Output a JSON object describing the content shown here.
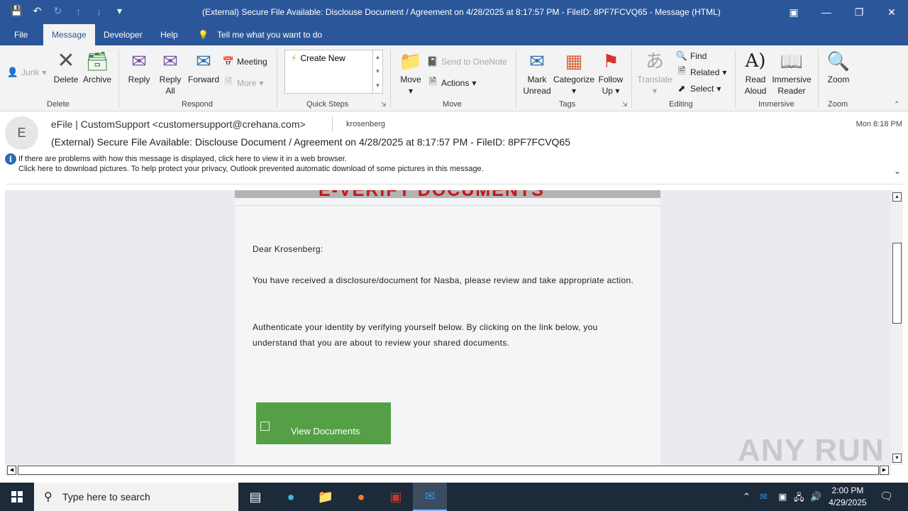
{
  "window": {
    "title": "(External) Secure File Available: Disclouse Document / Agreement on 4/28/2025 at 8:17:57 PM - FileID: 8PF7FCVQ65  -  Message (HTML)"
  },
  "tabs": [
    "File",
    "Message",
    "Developer",
    "Help"
  ],
  "tell_me": "Tell me what you want to do",
  "ribbon": {
    "delete_group": {
      "junk": "Junk",
      "delete": "Delete",
      "archive": "Archive",
      "label": "Delete"
    },
    "respond_group": {
      "reply": "Reply",
      "reply_all_1": "Reply",
      "reply_all_2": "All",
      "forward": "Forward",
      "meeting": "Meeting",
      "more": "More",
      "label": "Respond"
    },
    "quick_steps": {
      "create_new": "Create New",
      "label": "Quick Steps"
    },
    "move_group": {
      "move": "Move",
      "onenote": "Send to OneNote",
      "actions": "Actions",
      "label": "Move"
    },
    "tags_group": {
      "mark_1": "Mark",
      "mark_2": "Unread",
      "categorize": "Categorize",
      "follow_1": "Follow",
      "follow_2": "Up",
      "label": "Tags"
    },
    "editing_group": {
      "translate": "Translate",
      "find": "Find",
      "related": "Related",
      "select": "Select",
      "label": "Editing"
    },
    "immersive_group": {
      "read_1": "Read",
      "read_2": "Aloud",
      "imm_1": "Immersive",
      "imm_2": "Reader",
      "label": "Immersive"
    },
    "zoom_group": {
      "zoom": "Zoom",
      "label": "Zoom"
    }
  },
  "message": {
    "avatar_letter": "E",
    "from": "eFile | CustomSupport <customersupport@crehana.com>",
    "to": "krosenberg",
    "date": "Mon 8:18 PM",
    "subject": "(External) Secure File Available: Disclouse Document / Agreement on 4/28/2025 at 8:17:57 PM - FileID: 8PF7FCVQ65",
    "info_line1": "If there are problems with how this message is displayed, click here to view it in a web browser.",
    "info_line2": "Click here to download pictures. To help protect your privacy, Outlook prevented automatic download of some pictures in this message."
  },
  "email_body": {
    "banner": "E-VERIFY DOCUMENTS",
    "greeting": "Dear Krosenberg:",
    "para1": "You have received a disclosure/document for Nasba, please review and take appropriate action.",
    "para2": "Authenticate your identity by verifying yourself below. By clicking on the link below, you understand that you are about to review your shared documents.",
    "button": "View Documents"
  },
  "watermark": "ANY RUN",
  "taskbar": {
    "search_placeholder": "Type here to search",
    "time": "2:00 PM",
    "date": "4/29/2025"
  },
  "colors": {
    "accent": "#2b579a",
    "button_green": "#55a046",
    "banner_red": "#c8151c"
  }
}
